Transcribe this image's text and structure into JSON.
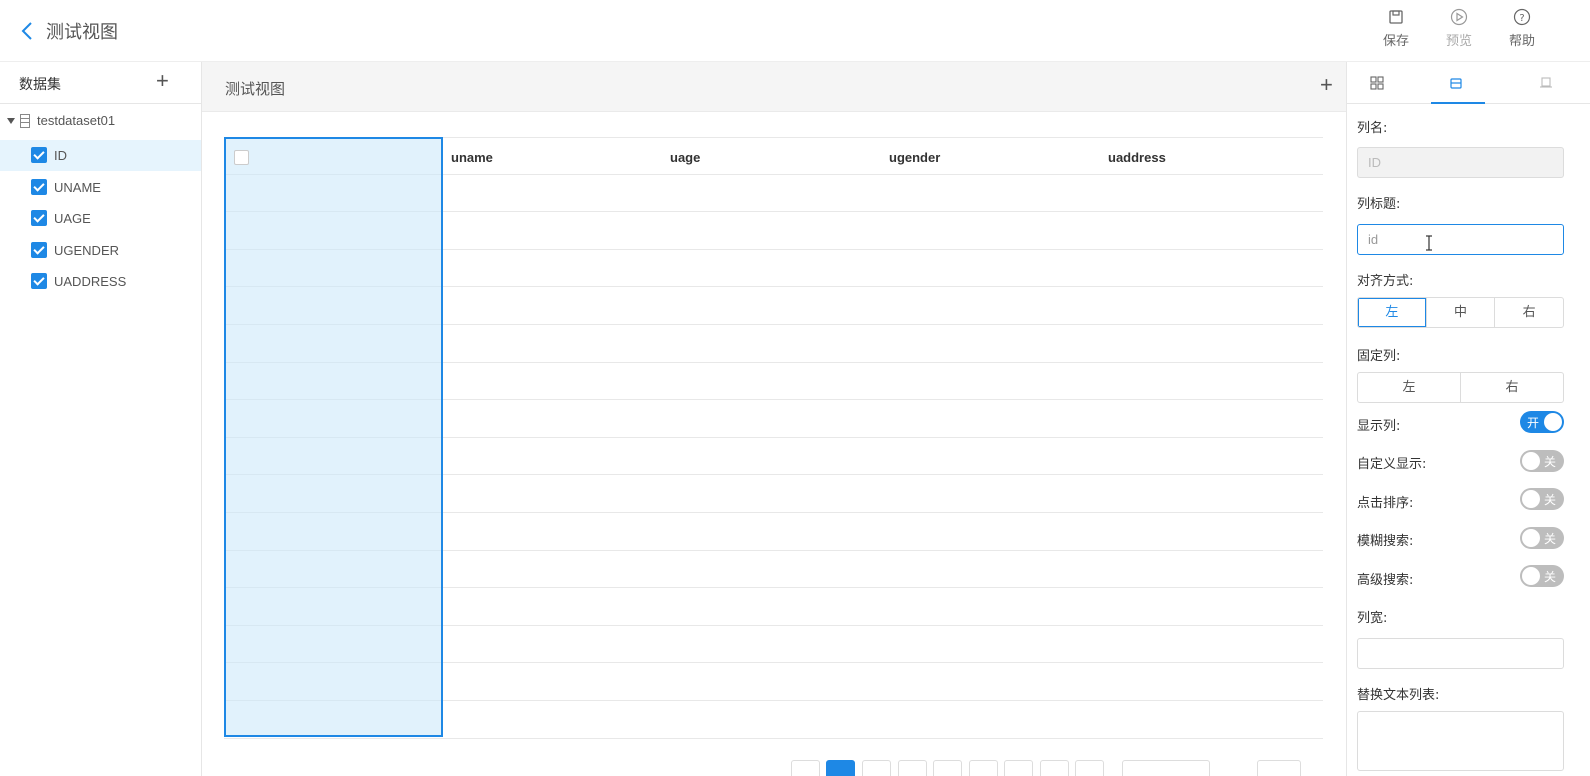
{
  "header": {
    "title": "测试视图",
    "tools": [
      {
        "label": "保存",
        "icon": "save-icon"
      },
      {
        "label": "预览",
        "icon": "play-icon"
      },
      {
        "label": "帮助",
        "icon": "help-icon"
      }
    ]
  },
  "sidebar": {
    "title": "数据集",
    "dataset": "testdataset01",
    "fields": [
      "ID",
      "UNAME",
      "UAGE",
      "UGENDER",
      "UADDRESS"
    ]
  },
  "center": {
    "title": "测试视图",
    "columns": [
      "uname",
      "uage",
      "ugender",
      "uaddress"
    ]
  },
  "props": {
    "col_name_label": "列名:",
    "col_name_value": "ID",
    "col_title_label": "列标题:",
    "col_title_placeholder": "id",
    "align_label": "对齐方式:",
    "align_options": [
      "左",
      "中",
      "右"
    ],
    "align_selected": "左",
    "fixed_label": "固定列:",
    "fixed_options": [
      "左",
      "右"
    ],
    "show_col_label": "显示列:",
    "show_col_state": "开",
    "custom_display_label": "自定义显示:",
    "custom_display_state": "关",
    "click_sort_label": "点击排序:",
    "click_sort_state": "关",
    "fuzzy_search_label": "模糊搜索:",
    "fuzzy_search_state": "关",
    "adv_search_label": "高级搜索:",
    "adv_search_state": "关",
    "col_width_label": "列宽:",
    "replace_text_label": "替换文本列表:"
  },
  "colors": {
    "accent": "#1e88e5"
  }
}
